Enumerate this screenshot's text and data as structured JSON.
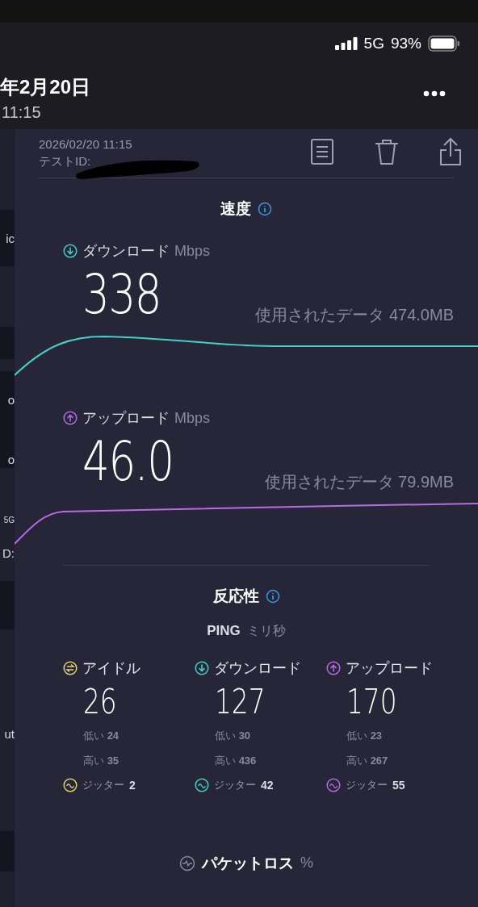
{
  "status_bar": {
    "network": "5G",
    "battery": "93%"
  },
  "header": {
    "date": "年2月20日",
    "time": "11:15"
  },
  "background_fragments": [
    "ic",
    "o",
    "o",
    "5G",
    "D:",
    "ut"
  ],
  "result": {
    "timestamp": "2026/02/20 11:15",
    "test_id": "テストID:"
  },
  "speed": {
    "title": "速度",
    "metrics": [
      {
        "kind": "download",
        "label": "ダウンロード",
        "unit": "Mbps",
        "value": "338",
        "data_used": "使用されたデータ 474.0MB",
        "color": "#3fd3c8"
      },
      {
        "kind": "upload",
        "label": "アップロード",
        "unit": "Mbps",
        "value": "46.0",
        "data_used": "使用されたデータ 79.9MB",
        "color": "#b46de6"
      }
    ]
  },
  "responsiveness": {
    "title": "反応性",
    "ping_label": "PING",
    "ping_unit": "ミリ秒",
    "columns": [
      {
        "kind": "idle",
        "label": "アイドル",
        "value": "26",
        "low": "低い **24**",
        "high": "高い **35**",
        "jitter_label": "ジッター",
        "jitter": "2",
        "color": "#e2d46a"
      },
      {
        "kind": "download",
        "label": "ダウンロード",
        "value": "127",
        "low": "低い **30**",
        "high": "高い **436**",
        "jitter_label": "ジッター",
        "jitter": "42",
        "color": "#3fd3c8"
      },
      {
        "kind": "upload",
        "label": "アップロード",
        "value": "170",
        "low": "低い **23**",
        "high": "高い **267**",
        "jitter_label": "ジッター",
        "jitter": "55",
        "color": "#b46de6"
      }
    ]
  },
  "packet_loss": {
    "label": "パケットロス",
    "unit": "%"
  }
}
